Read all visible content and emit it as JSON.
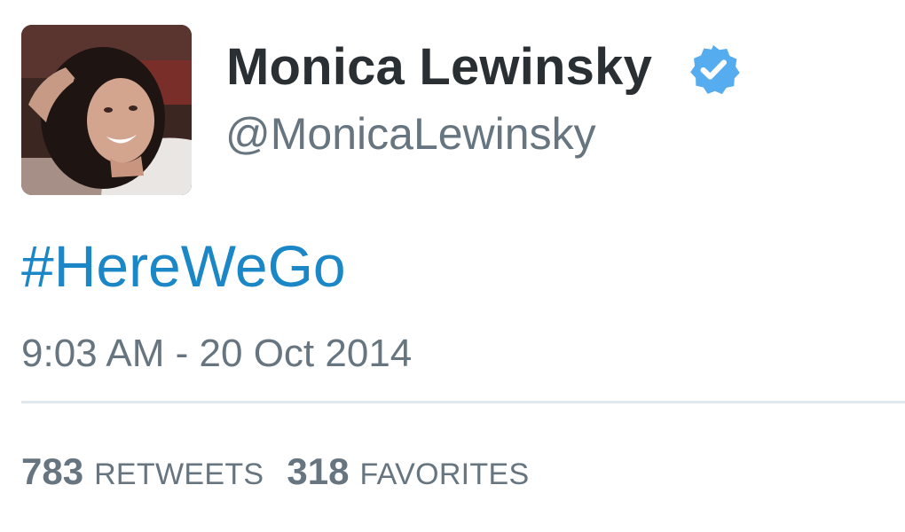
{
  "user": {
    "display_name": "Monica Lewinsky",
    "handle": "@MonicaLewinsky",
    "verified": true,
    "avatar_icon": "profile-photo"
  },
  "tweet": {
    "hashtag": "#HereWeGo",
    "timestamp": "9:03 AM - 20 Oct 2014"
  },
  "stats": {
    "retweets_count": "783",
    "retweets_label": "RETWEETS",
    "favorites_count": "318",
    "favorites_label": "FAVORITES"
  },
  "colors": {
    "name": "#292f33",
    "secondary": "#66757f",
    "link": "#1b87c7",
    "verified_badge": "#55acee",
    "divider": "#e1e8ed"
  }
}
